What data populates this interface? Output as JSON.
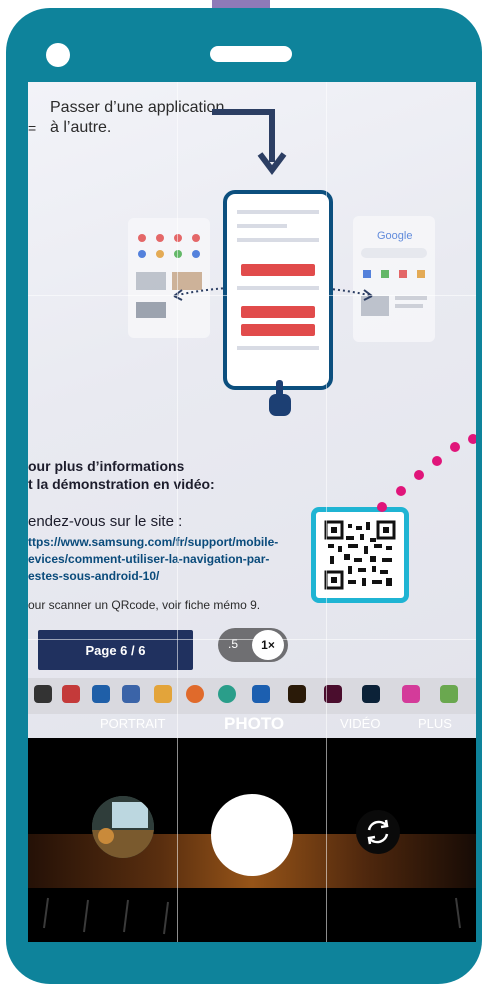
{
  "slide": {
    "title_line1": "Passer d’une application",
    "title_line2": "à l’autre.",
    "info_line1": "our plus d’informations",
    "info_line2": "t la démonstration en vidéo:",
    "rendez": "endez-vous sur le site :",
    "url_line1": "ttps://www.samsung.com/fr/support/mobile-",
    "url_line2": "evices/comment-utiliser-la-navigation-par-",
    "url_line3": "estes-sous-android-10/",
    "scan_note": "our scanner un QRcode, voir fiche mémo 9.",
    "page_label": "Page  6 / 6",
    "ghost_right_title": "Google"
  },
  "camera": {
    "zoom_options": [
      ".5",
      "1×"
    ],
    "zoom_selected": "1×",
    "modes": [
      "PORTRAIT",
      "PHOTO",
      "VIDÉO",
      "PLUS"
    ],
    "active_mode": "PHOTO"
  },
  "colors": {
    "phone_frame": "#0e839b",
    "top_tab": "#8e7ab8",
    "qr_border": "#1fb4d3",
    "dots": "#e0157a",
    "page_button": "#20315f"
  },
  "icons": {
    "shutter": "shutter-button",
    "switch_camera": "flip-camera-icon",
    "gallery": "gallery-thumbnail"
  }
}
